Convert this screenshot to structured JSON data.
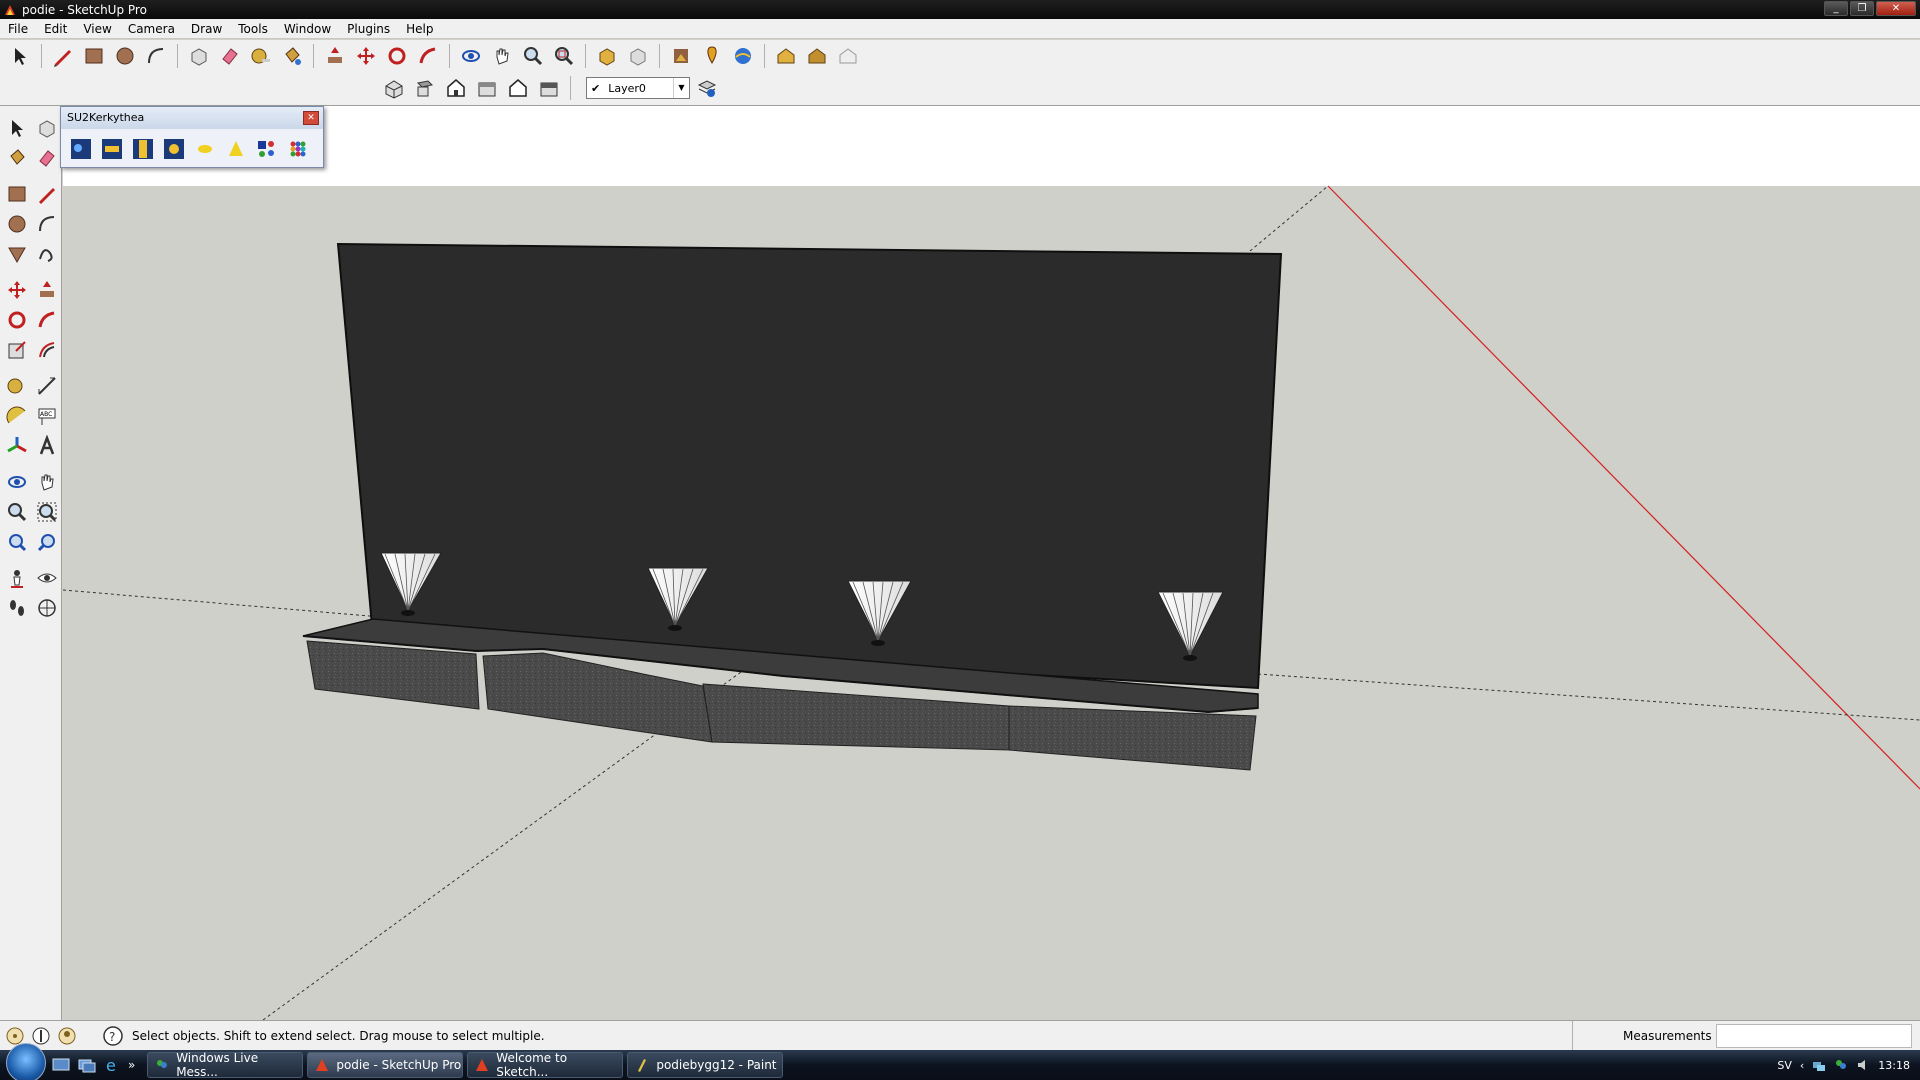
{
  "window": {
    "title": "podie - SketchUp Pro"
  },
  "menu": [
    "File",
    "Edit",
    "View",
    "Camera",
    "Draw",
    "Tools",
    "Window",
    "Plugins",
    "Help"
  ],
  "layer_toolbar": {
    "selected": "Layer0"
  },
  "plugin_panel": {
    "title": "SU2Kerkythea"
  },
  "statusbar": {
    "hint": "Select objects. Shift to extend select. Drag mouse to select multiple.",
    "measurements_label": "Measurements",
    "measurements_value": ""
  },
  "taskbar": {
    "items": [
      {
        "label": "Windows Live Mess...",
        "active": false
      },
      {
        "label": "podie - SketchUp Pro",
        "active": true
      },
      {
        "label": "Welcome to Sketch...",
        "active": false
      },
      {
        "label": "podiebygg12 - Paint",
        "active": false
      }
    ],
    "language": "SV",
    "clock": "13:18"
  },
  "colors": {
    "sky": "#ffffff",
    "ground": "#d0d0cb",
    "wall": "#2b2b2b",
    "podium_top": "#3c3c3c",
    "podium_side": "#4a4a4a",
    "red_axis": "#d42020",
    "title_bar": "#0f0f0f",
    "toolbar_bg": "#f0f0f0"
  },
  "icons": {
    "top_toolbar_1": [
      "select-icon",
      "pencil-icon",
      "rectangle-icon",
      "circle-icon",
      "arc-icon",
      "make-component-icon",
      "eraser-icon",
      "tape-measure-icon",
      "paint-bucket-icon",
      "push-pull-icon",
      "move-icon",
      "rotate-icon",
      "follow-me-icon",
      "orbit-icon",
      "pan-icon",
      "zoom-icon",
      "zoom-extents-icon",
      "get-models-icon",
      "share-model-icon",
      "get-photo-texture-icon",
      "add-location-icon",
      "toggle-terrain-icon",
      "warehouse-icon",
      "share-component-icon",
      "3d-warehouse-icon"
    ],
    "top_toolbar_2": [
      "iso-view-icon",
      "top-view-icon",
      "front-view-icon",
      "right-view-icon",
      "back-view-icon",
      "left-view-icon"
    ]
  }
}
